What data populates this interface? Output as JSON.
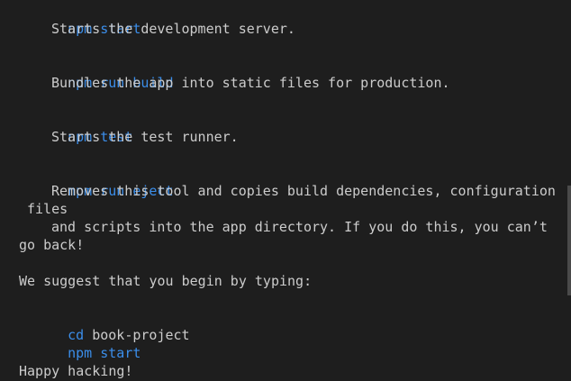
{
  "terminal": {
    "lines": {
      "l0": {
        "parts": [
          {
            "text": "npm",
            "kind": "cmd"
          },
          {
            "text": " ",
            "kind": "txt"
          },
          {
            "text": "start",
            "kind": "cmd"
          }
        ]
      },
      "l1": {
        "text": "Starts the development server."
      },
      "l2": {
        "parts": [
          {
            "text": "npm",
            "kind": "cmd"
          },
          {
            "text": " ",
            "kind": "txt"
          },
          {
            "text": "run build",
            "kind": "cmd"
          }
        ]
      },
      "l3": {
        "text": "Bundles the app into static files for production."
      },
      "l4": {
        "parts": [
          {
            "text": "npm",
            "kind": "cmd"
          },
          {
            "text": " ",
            "kind": "txt"
          },
          {
            "text": "test",
            "kind": "cmd"
          }
        ]
      },
      "l5": {
        "text": "Starts the test runner."
      },
      "l6": {
        "parts": [
          {
            "text": "npm",
            "kind": "cmd"
          },
          {
            "text": " ",
            "kind": "txt"
          },
          {
            "text": "run eject",
            "kind": "cmd"
          }
        ]
      },
      "l7": {
        "text": "Removes this tool and copies build dependencies, configuration"
      },
      "l8": {
        "text": "files"
      },
      "l9": {
        "text": "and scripts into the app directory. If you do this, you can’t"
      },
      "l10": {
        "text": "go back!"
      },
      "l11": {
        "text": "We suggest that you begin by typing:"
      },
      "l12": {
        "cmd": "cd",
        "arg": " book-project"
      },
      "l13": {
        "parts": [
          {
            "text": "npm",
            "kind": "cmd"
          },
          {
            "text": " ",
            "kind": "txt"
          },
          {
            "text": "start",
            "kind": "cmd"
          }
        ]
      },
      "l14": {
        "text": "Happy hacking!"
      }
    }
  },
  "colors": {
    "background": "#1e1e1e",
    "text": "#cccccc",
    "command": "#3b8eea"
  }
}
